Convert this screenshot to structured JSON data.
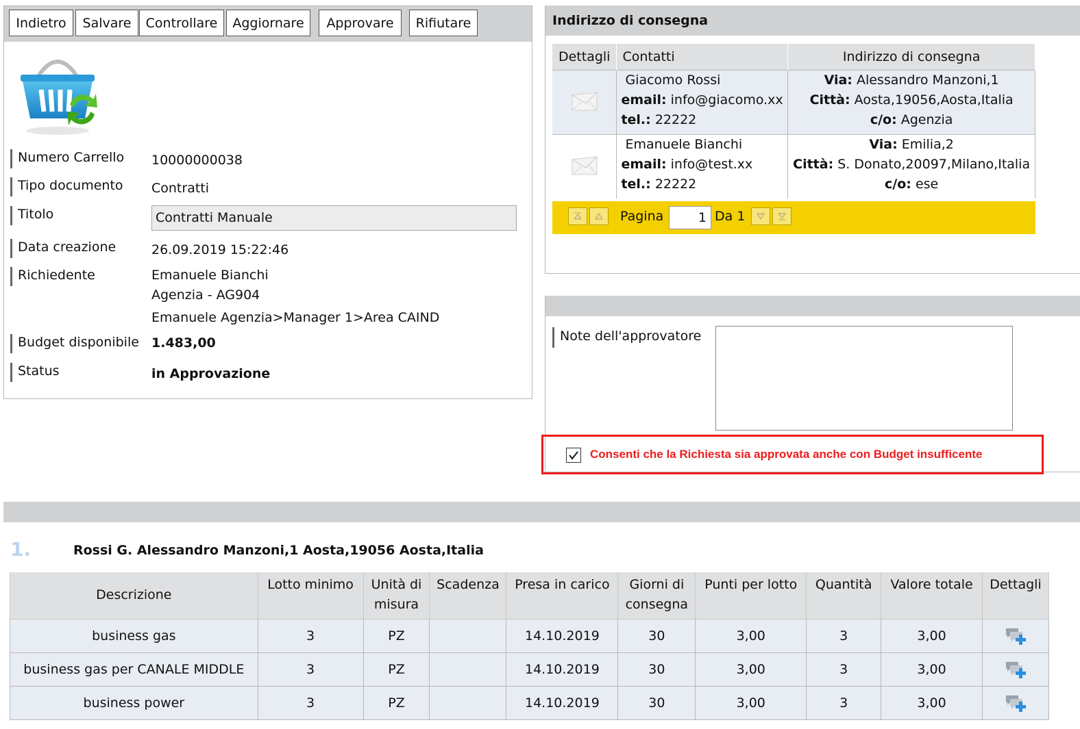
{
  "toolbar": {
    "buttons": [
      "Indietro",
      "Salvare",
      "Controllare",
      "Aggiornare",
      "Approvare",
      "Rifiutare"
    ]
  },
  "cart": {
    "icon": "shopping-basket-refresh-icon",
    "fields": [
      {
        "label": "Numero Carrello",
        "value": "10000000038"
      },
      {
        "label": "Tipo documento",
        "value": "Contratti"
      },
      {
        "label": "Titolo",
        "value": "Contratti Manuale"
      },
      {
        "label": "Data creazione",
        "value": "26.09.2019 15:22:46"
      },
      {
        "label": "Richiedente",
        "lines": [
          "Emanuele Bianchi",
          "Agenzia - AG904",
          "Emanuele Agenzia>Manager 1>Area CAIND"
        ]
      },
      {
        "label": "Budget disponibile",
        "value": "1.483,00"
      },
      {
        "label": "Status",
        "value": "in Approvazione"
      }
    ]
  },
  "delivery": {
    "title": "Indirizzo di consegna",
    "columns": [
      "Dettagli",
      "Contatti",
      "Indirizzo di consegna"
    ],
    "rows": [
      {
        "name": "Giacomo Rossi",
        "email_label": "email:",
        "email": "info@giacomo.xx",
        "tel_label": "tel.:",
        "tel": "22222",
        "via_label": "Via:",
        "via": "Alessandro Manzoni,1",
        "citta_label": "Città:",
        "citta": "Aosta,19056,Aosta,Italia",
        "co_label": "c/o:",
        "co": "Agenzia"
      },
      {
        "name": "Emanuele Bianchi",
        "email_label": "email:",
        "email": "info@test.xx",
        "tel_label": "tel.:",
        "tel": "22222",
        "via_label": "Via:",
        "via": "Emilia,2",
        "citta_label": "Città:",
        "citta": "S. Donato,20097,Milano,Italia",
        "co_label": "c/o:",
        "co": "ese"
      }
    ],
    "pager": {
      "label": "Pagina",
      "page": "1",
      "of": "Da 1"
    }
  },
  "notes": {
    "label": "Note dell'approvatore",
    "value": ""
  },
  "budget_override": {
    "checked": true,
    "label": "Consenti che la Richiesta sia approvata anche con Budget insufficente"
  },
  "items": {
    "number": "1.",
    "address": "Rossi   G.   Alessandro Manzoni,1   Aosta,19056   Aosta,Italia",
    "columns": [
      "Descrizione",
      "Lotto minimo",
      "Unità di misura",
      "Scadenza",
      "Presa in carico",
      "Giorni di consegna",
      "Punti per lotto",
      "Quantità",
      "Valore totale",
      "Dettagli"
    ],
    "rows": [
      {
        "descrizione": "business gas",
        "lotto": "3",
        "unita": "PZ",
        "scadenza": "",
        "presa": "14.10.2019",
        "giorni": "30",
        "punti": "3,00",
        "quantita": "3",
        "valore": "3,00"
      },
      {
        "descrizione": "business gas per CANALE MIDDLE",
        "lotto": "3",
        "unita": "PZ",
        "scadenza": "",
        "presa": "14.10.2019",
        "giorni": "30",
        "punti": "3,00",
        "quantita": "3",
        "valore": "3,00"
      },
      {
        "descrizione": "business power",
        "lotto": "3",
        "unita": "PZ",
        "scadenza": "",
        "presa": "14.10.2019",
        "giorni": "30",
        "punti": "3,00",
        "quantita": "3",
        "valore": "3,00"
      }
    ]
  },
  "colors": {
    "header_gray": "#cfd1d3",
    "pager_yellow": "#f4d000",
    "highlight_red": "#ee1c1c",
    "row_blue": "#e8ecf3",
    "item_number_blue": "#b9d5ef"
  }
}
